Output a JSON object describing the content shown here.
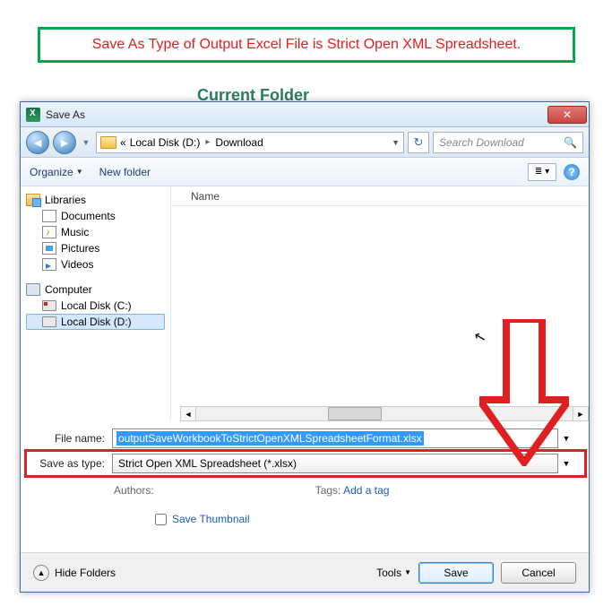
{
  "annotation": "Save As Type of Output Excel File is Strict Open XML Spreadsheet.",
  "bg_text": "Current Folder",
  "dialog": {
    "title": "Save As",
    "path": {
      "root": "Local Disk (D:)",
      "sub": "Download"
    },
    "search_placeholder": "Search Download",
    "toolbar": {
      "organize": "Organize",
      "new_folder": "New folder"
    },
    "columns": {
      "name": "Name"
    },
    "sidebar": {
      "libraries": "Libraries",
      "documents": "Documents",
      "music": "Music",
      "pictures": "Pictures",
      "videos": "Videos",
      "computer": "Computer",
      "disk_c": "Local Disk (C:)",
      "disk_d": "Local Disk (D:)"
    },
    "file_name_label": "File name:",
    "file_name_value": "outputSaveWorkbookToStrictOpenXMLSpreadsheetFormat.xlsx",
    "save_type_label": "Save as type:",
    "save_type_value": "Strict Open XML Spreadsheet (*.xlsx)",
    "authors_label": "Authors:",
    "tags_label": "Tags:",
    "tags_link": "Add a tag",
    "save_thumbnail": "Save Thumbnail",
    "hide_folders": "Hide Folders",
    "tools": "Tools",
    "save": "Save",
    "cancel": "Cancel"
  }
}
